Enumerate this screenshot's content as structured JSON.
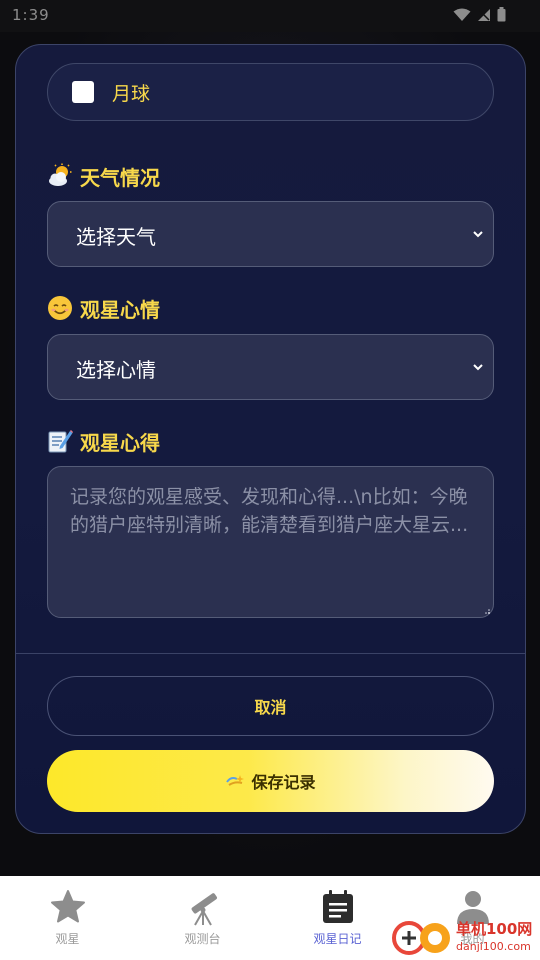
{
  "status_bar": {
    "time": "1:39"
  },
  "dialog": {
    "moon_option": {
      "label": "月球",
      "checked": false
    },
    "weather": {
      "label": "天气情况",
      "icon": "sun-behind-cloud-icon",
      "selected": "选择天气"
    },
    "mood": {
      "label": "观星心情",
      "icon": "smiling-face-icon",
      "selected": "选择心情"
    },
    "notes": {
      "label": "观星心得",
      "icon": "memo-icon",
      "placeholder": "记录您的观星感受、发现和心得...\\n比如：今晚的猎户座特别清晰，能清楚看到猎户座大星云..."
    },
    "cancel_label": "取消",
    "save_label": "保存记录",
    "save_icon": "sparkle-icon"
  },
  "tabbar": {
    "items": [
      {
        "label": "观星",
        "icon": "star-icon",
        "active": false
      },
      {
        "label": "观测台",
        "icon": "telescope-icon",
        "active": false
      },
      {
        "label": "观星日记",
        "icon": "diary-icon",
        "active": true
      },
      {
        "label": "我的",
        "icon": "user-icon",
        "active": false
      }
    ]
  },
  "watermark": {
    "text": "单机100网",
    "url": "danji100.com"
  },
  "colors": {
    "accent_yellow": "#f7d84b",
    "active_tab": "#5b63d3",
    "dialog_bg": "#141a3e",
    "field_bg": "#2b3050"
  }
}
